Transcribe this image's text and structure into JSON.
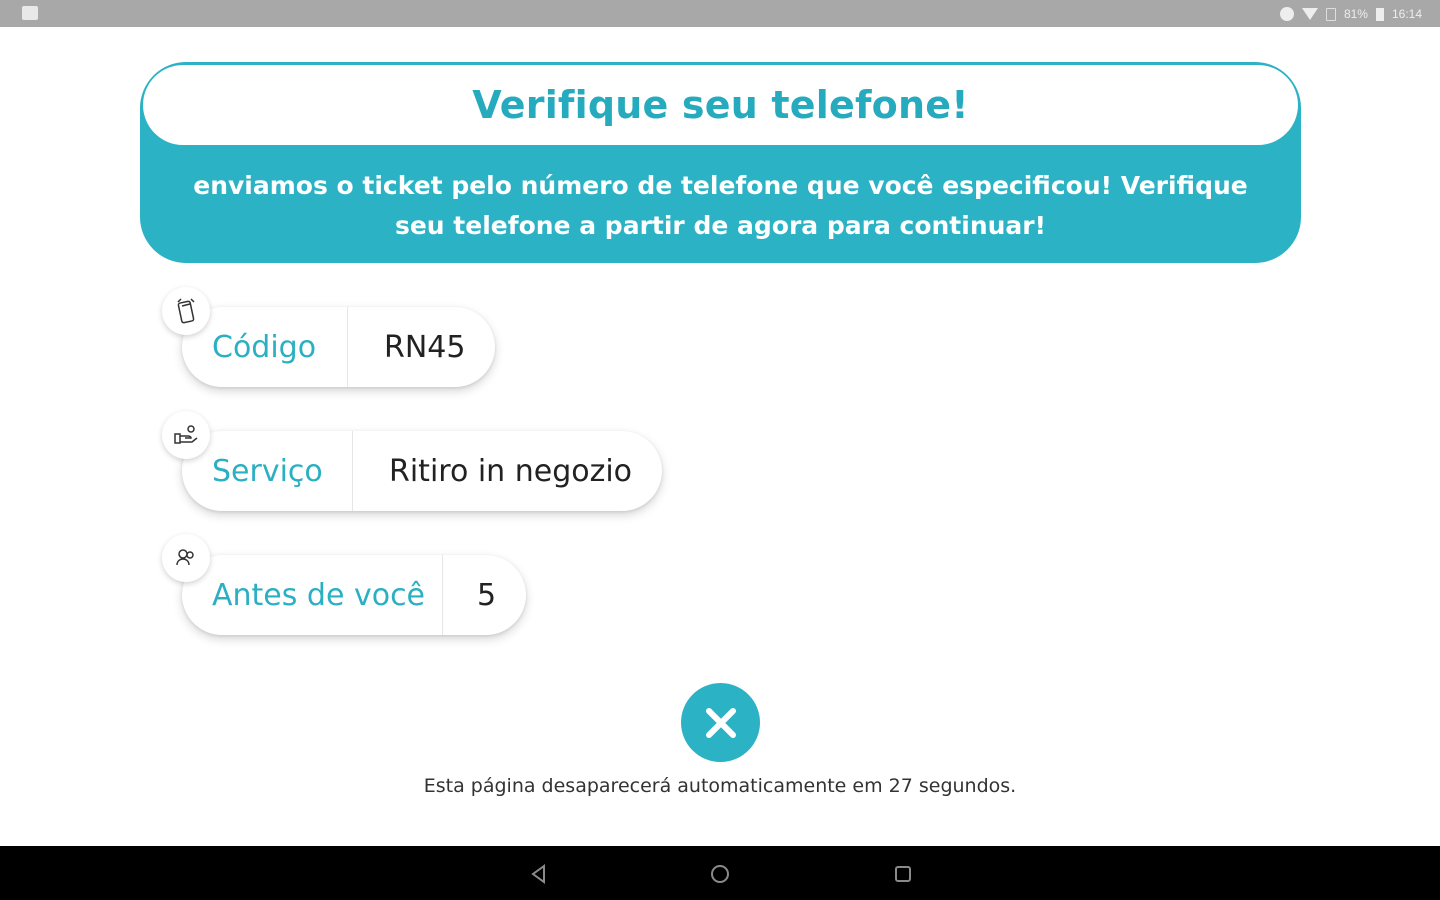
{
  "status_bar": {
    "battery": "81%",
    "time": "16:14"
  },
  "header": {
    "title": "Verifique seu telefone!",
    "message": "enviamos o ticket pelo número de telefone que você especificou! Verifique seu telefone a partir de agora para continuar!"
  },
  "ticket": {
    "code": {
      "label": "Código",
      "value": "RN45",
      "icon": "phone-ticket-icon"
    },
    "service": {
      "label": "Serviço",
      "value": "Ritiro in negozio",
      "icon": "hand-service-icon"
    },
    "ahead": {
      "label": "Antes de você",
      "value": "5",
      "icon": "people-queue-icon"
    }
  },
  "close_button": {
    "icon": "close-icon"
  },
  "auto_close_text": "Esta página desaparecerá automaticamente em 27 segundos.",
  "colors": {
    "accent": "#2bb2c5",
    "text_dark": "#222222",
    "background": "#ffffff"
  },
  "navigation": {
    "back_icon": "back-triangle-icon",
    "home_icon": "home-circle-icon",
    "recents_icon": "recents-square-icon"
  }
}
